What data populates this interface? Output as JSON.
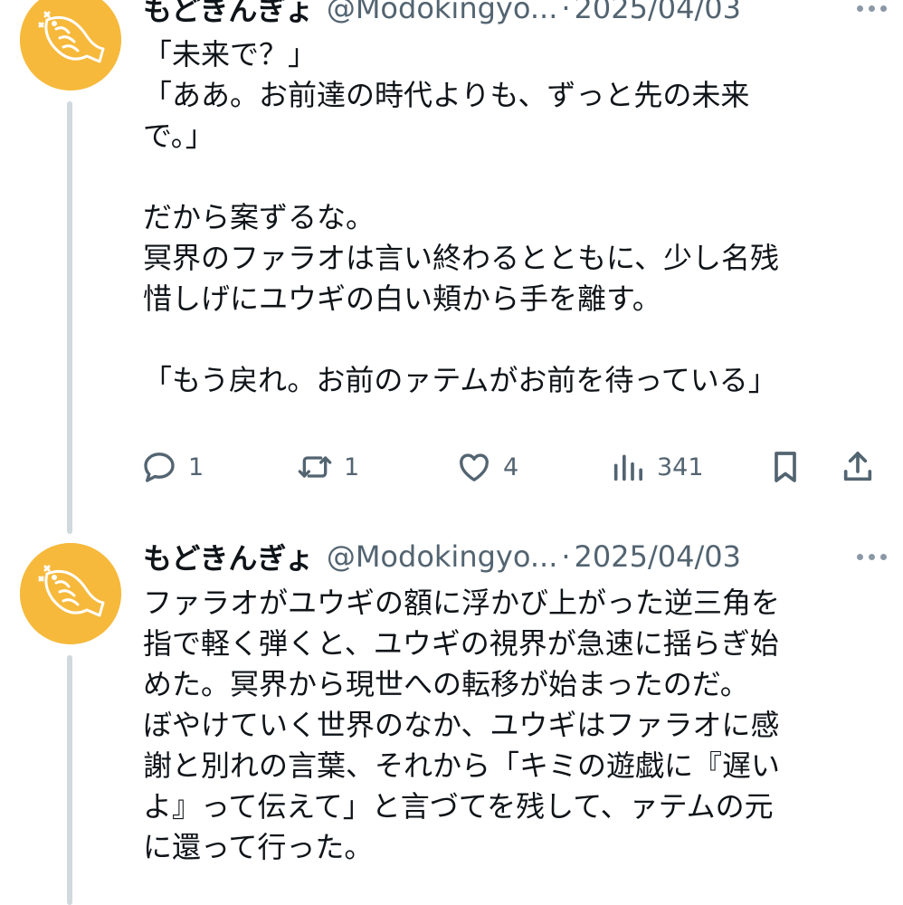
{
  "tweets": [
    {
      "display_name": "もどきんぎょ",
      "handle": "@Modokingyo...",
      "separator": "·",
      "date": "2025/04/03",
      "lines": [
        "「未来で？」",
        "「ああ。お前達の時代よりも、ずっと先の未来",
        "で。」",
        "",
        "だから案ずるな。",
        "冥界のファラオは言い終わるとともに、少し名残",
        "惜しげにユウギの白い頬から手を離す。",
        "",
        "「もう戻れ。お前のァテムがお前を待っている」"
      ],
      "stats": {
        "replies": "1",
        "retweets": "1",
        "likes": "4",
        "views": "341"
      }
    },
    {
      "display_name": "もどきんぎょ",
      "handle": "@Modokingyo...",
      "separator": "·",
      "date": "2025/04/03",
      "lines": [
        "ファラオがユウギの額に浮かび上がった逆三角を",
        "指で軽く弾くと、ユウギの視界が急速に揺らぎ始",
        "めた。冥界から現世への転移が始まったのだ。",
        "ぼやけていく世界のなか、ユウギはファラオに感",
        "謝と別れの言葉、それから「キミの遊戯に『遅い",
        "よ』って伝えて」と言づてを残して、ァテムの元",
        "に還って行った。"
      ]
    }
  ],
  "icons": {
    "avatar": "goldfish-avatar-icon",
    "more": "more-options-icon",
    "reply": "reply-icon",
    "retweet": "retweet-icon",
    "like": "heart-icon",
    "views": "views-chart-icon",
    "bookmark": "bookmark-icon",
    "share": "share-icon"
  },
  "colors": {
    "avatar_bg": "#f6b93b",
    "thread_line": "#cfd9de",
    "secondary_text": "#536471",
    "primary_text": "#0f1419"
  }
}
